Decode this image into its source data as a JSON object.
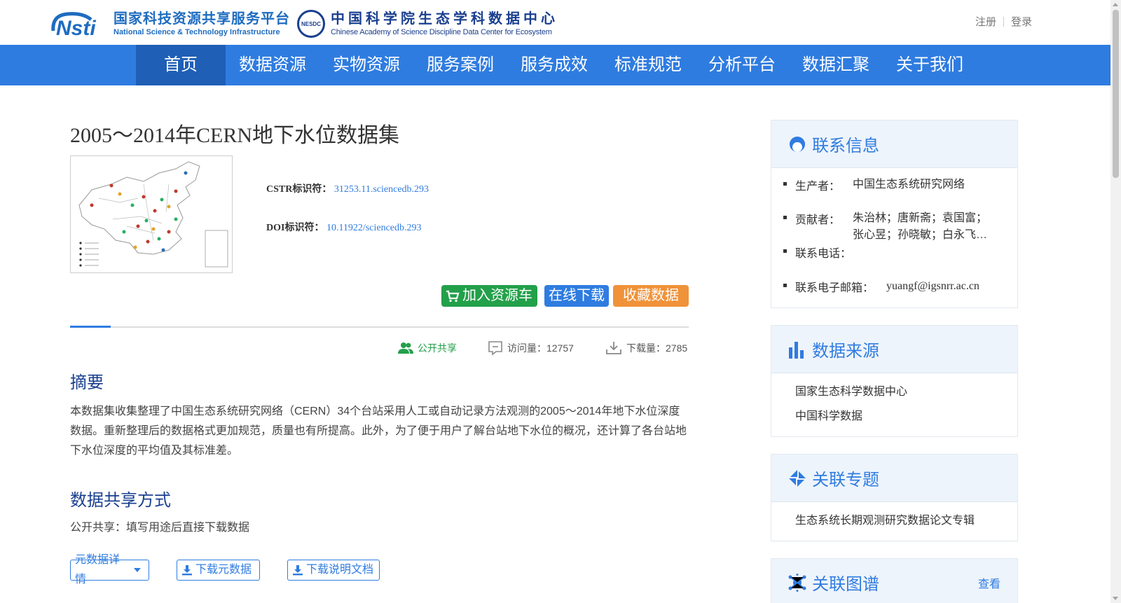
{
  "header": {
    "logo1_mark": "Nsti",
    "logo1_cn": "国家科技资源共享服务平台",
    "logo1_en": "National Science & Technology Infrastructure",
    "logo2_badge": "NESDC",
    "logo2_cn": "中国科学院生态学科数据中心",
    "logo2_en": "Chinese Academy of Science Discipline Data Center for Ecosystem",
    "register": "注册",
    "login": "登录"
  },
  "nav": [
    "首页",
    "数据资源",
    "实物资源",
    "服务案例",
    "服务成效",
    "标准规范",
    "分析平台",
    "数据汇聚",
    "关于我们"
  ],
  "dataset": {
    "title": "2005～2014年CERN地下水位数据集",
    "cstr_label": "CSTR标识符：",
    "cstr_value": "31253.11.sciencedb.293",
    "doi_label": "DOI标识符：",
    "doi_value": "10.11922/sciencedb.293",
    "btn_cart": "加入资源车",
    "btn_download": "在线下载",
    "btn_favorite": "收藏数据集",
    "share_status": "公开共享",
    "visits_label": "访问量：",
    "visits": "12757",
    "downloads_label": "下载量：",
    "downloads": "2785"
  },
  "abstract": {
    "heading": "摘要",
    "text": "本数据集收集整理了中国生态系统研究网络（CERN）34个台站采用人工或自动记录方法观测的2005～2014年地下水位深度数据。重新整理后的数据格式更加规范，质量也有所提高。此外，为了便于用户了解台站地下水位的概况，还计算了各台站地下水位深度的平均值及其标准差。"
  },
  "sharing": {
    "heading": "数据共享方式",
    "text": "公开共享：填写用途后直接下载数据"
  },
  "actions": {
    "metadata_detail": "元数据详情",
    "download_metadata": "下载元数据",
    "download_doc": "下载说明文档"
  },
  "sidebar": {
    "contact": {
      "title": "联系信息",
      "producer_label": "生产者：",
      "producer": "中国生态系统研究网络",
      "contrib_label": "贡献者：",
      "contrib_line1": "朱治林；唐新斋；袁国富；",
      "contrib_line2": "张心昱；孙晓敏；白永飞…",
      "phone_label": "联系电话：",
      "email_label": "联系电子邮箱：",
      "email": "yuangf@igsnrr.ac.cn"
    },
    "source": {
      "title": "数据来源",
      "items": [
        "国家生态科学数据中心",
        "中国科学数据"
      ]
    },
    "topic": {
      "title": "关联专题",
      "items": [
        "生态系统长期观测研究数据论文专辑"
      ]
    },
    "graph": {
      "title": "关联图谱",
      "more": "查看"
    }
  },
  "colors": {
    "nav_bg": "#2f7ce0",
    "nav_active": "#1f5fb6",
    "cart_green": "#23a04a",
    "download_blue": "#2f7ce0",
    "favorite_orange": "#f0923a",
    "heading_navy": "#1a3f8f"
  }
}
